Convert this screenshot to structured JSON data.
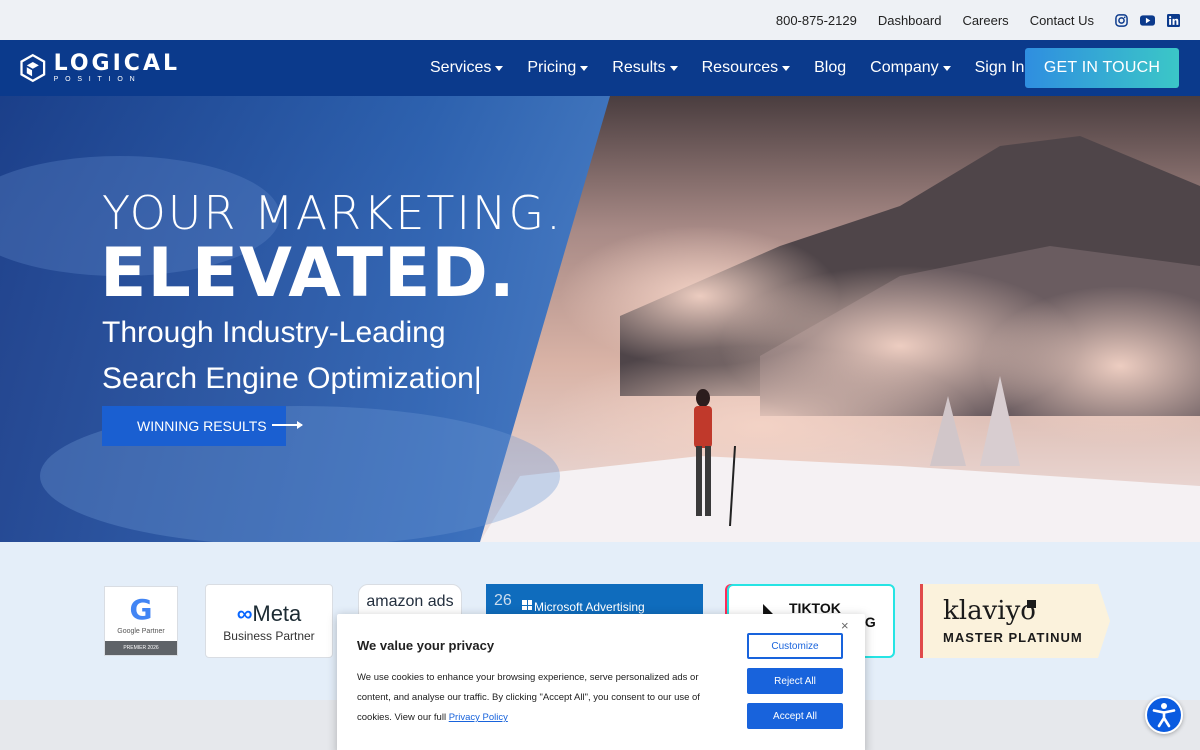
{
  "topbar": {
    "phone": "800-875-2129",
    "links": [
      "Dashboard",
      "Careers",
      "Contact Us"
    ],
    "social_icons": [
      "instagram-icon",
      "youtube-icon",
      "linkedin-icon"
    ]
  },
  "brand": {
    "name_line1": "LOGICAL",
    "name_line2": "POSITION"
  },
  "nav": {
    "items": [
      {
        "label": "Services",
        "dropdown": true
      },
      {
        "label": "Pricing",
        "dropdown": true
      },
      {
        "label": "Results",
        "dropdown": true
      },
      {
        "label": "Resources",
        "dropdown": true
      },
      {
        "label": "Blog",
        "dropdown": false
      },
      {
        "label": "Company",
        "dropdown": true
      },
      {
        "label": "Sign In",
        "dropdown": false
      }
    ],
    "cta_label": "GET IN TOUCH"
  },
  "hero": {
    "line1": "YOUR MARKETING.",
    "line2": "ELEVATED.",
    "sub1": "Through Industry-Leading",
    "sub2": "Search Engine Optimization|",
    "button_label": "WINNING RESULTS"
  },
  "partners": {
    "google": {
      "name": "G",
      "label": "Google Partner",
      "tier": "PREMIER 2026"
    },
    "meta": {
      "name": "Meta",
      "label": "Business Partner"
    },
    "amazon": {
      "name": "amazon ads"
    },
    "microsoft": {
      "num": "26",
      "name": "Microsoft Advertising"
    },
    "tiktok": {
      "name": "TIKTOK",
      "suffix": "IG"
    },
    "klaviyo": {
      "name": "klaviyo",
      "tier": "MASTER PLATINUM"
    }
  },
  "cookie": {
    "title": "We value your privacy",
    "body": "We use cookies to enhance your browsing experience, serve personalized ads or content, and analyse our traffic. By clicking \"Accept All\", you consent to our use of cookies. View our full",
    "policy_link": "Privacy Policy",
    "close": "×",
    "customize": "Customize",
    "reject": "Reject All",
    "accept": "Accept All"
  },
  "colors": {
    "nav_bg": "#0b3a8c",
    "cta_gradient_start": "#2f8ee0",
    "cta_gradient_end": "#3bc7c7",
    "accent_blue": "#1863dc",
    "hero_button": "#1a5fd1"
  },
  "accessibility_icon": "accessibility-icon"
}
